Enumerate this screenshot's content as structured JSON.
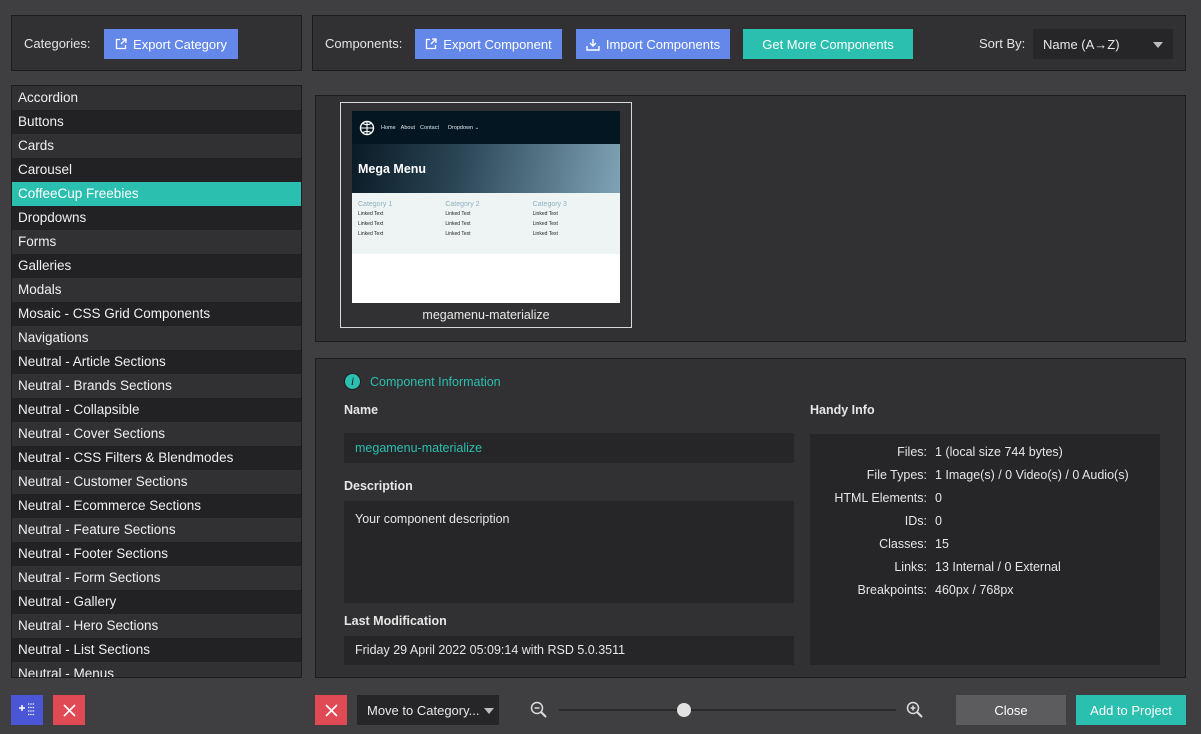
{
  "colors": {
    "accent_teal": "#2bbfb0",
    "button_blue": "#6488ea",
    "danger_red": "#e04a55",
    "add_blue": "#4a56d6"
  },
  "categories_bar": {
    "label": "Categories:",
    "export_button": {
      "label": "Export Category",
      "icon": "external-link-icon"
    }
  },
  "components_bar": {
    "label": "Components:",
    "export_button": {
      "label": "Export Component",
      "icon": "external-link-icon"
    },
    "import_button": {
      "label": "Import Components",
      "icon": "download-icon"
    },
    "more_button": {
      "label": "Get More Components"
    },
    "sort_label": "Sort By:",
    "sort_value": "Name (A→Z)"
  },
  "categories": [
    "Accordion",
    "Buttons",
    "Cards",
    "Carousel",
    "CoffeeCup Freebies",
    "Dropdowns",
    "Forms",
    "Galleries",
    "Modals",
    "Mosaic - CSS Grid Components",
    "Navigations",
    "Neutral - Article Sections",
    "Neutral - Brands Sections",
    "Neutral - Collapsible",
    "Neutral - Cover Sections",
    "Neutral - CSS Filters & Blendmodes",
    "Neutral - Customer Sections",
    "Neutral - Ecommerce Sections",
    "Neutral - Feature Sections",
    "Neutral - Footer Sections",
    "Neutral - Form Sections",
    "Neutral - Gallery",
    "Neutral - Hero Sections",
    "Neutral - List Sections",
    "Neutral - Menus"
  ],
  "selected_category": "CoffeeCup Freebies",
  "components": [
    {
      "name": "megamenu-materialize",
      "thumbnail": {
        "nav": [
          "Home",
          "About",
          "Contact",
          "Dropdown ⌄"
        ],
        "hero_title": "Mega Menu",
        "columns": [
          {
            "heading": "Category 1",
            "links": [
              "Linked Text",
              "Linked Text",
              "Linked Text"
            ]
          },
          {
            "heading": "Category 2",
            "links": [
              "Linked Text",
              "Linked Text",
              "Linked Text"
            ]
          },
          {
            "heading": "Category 3",
            "links": [
              "Linked Text",
              "Linked Text",
              "Linked Text"
            ]
          }
        ]
      }
    }
  ],
  "info": {
    "title": "Component Information",
    "name_label": "Name",
    "name_value": "megamenu-materialize",
    "description_label": "Description",
    "description_value": "Your component description",
    "last_mod_label": "Last Modification",
    "last_mod_value": "Friday 29 April 2022 05:09:14 with RSD 5.0.3511",
    "handy_label": "Handy Info",
    "handy": [
      {
        "key": "Files:",
        "value": "1 (local size 744 bytes)"
      },
      {
        "key": "File Types:",
        "value": "1 Image(s) / 0 Video(s) / 0 Audio(s)"
      },
      {
        "key": "HTML Elements:",
        "value": "0"
      },
      {
        "key": "IDs:",
        "value": "0"
      },
      {
        "key": "Classes:",
        "value": "15"
      },
      {
        "key": "Links:",
        "value": "13 Internal / 0 External"
      },
      {
        "key": "Breakpoints:",
        "value": "460px / 768px"
      }
    ]
  },
  "bottom": {
    "move_select": "Move to Category...",
    "zoom_level": 0.37,
    "close_label": "Close",
    "add_label": "Add to Project"
  }
}
